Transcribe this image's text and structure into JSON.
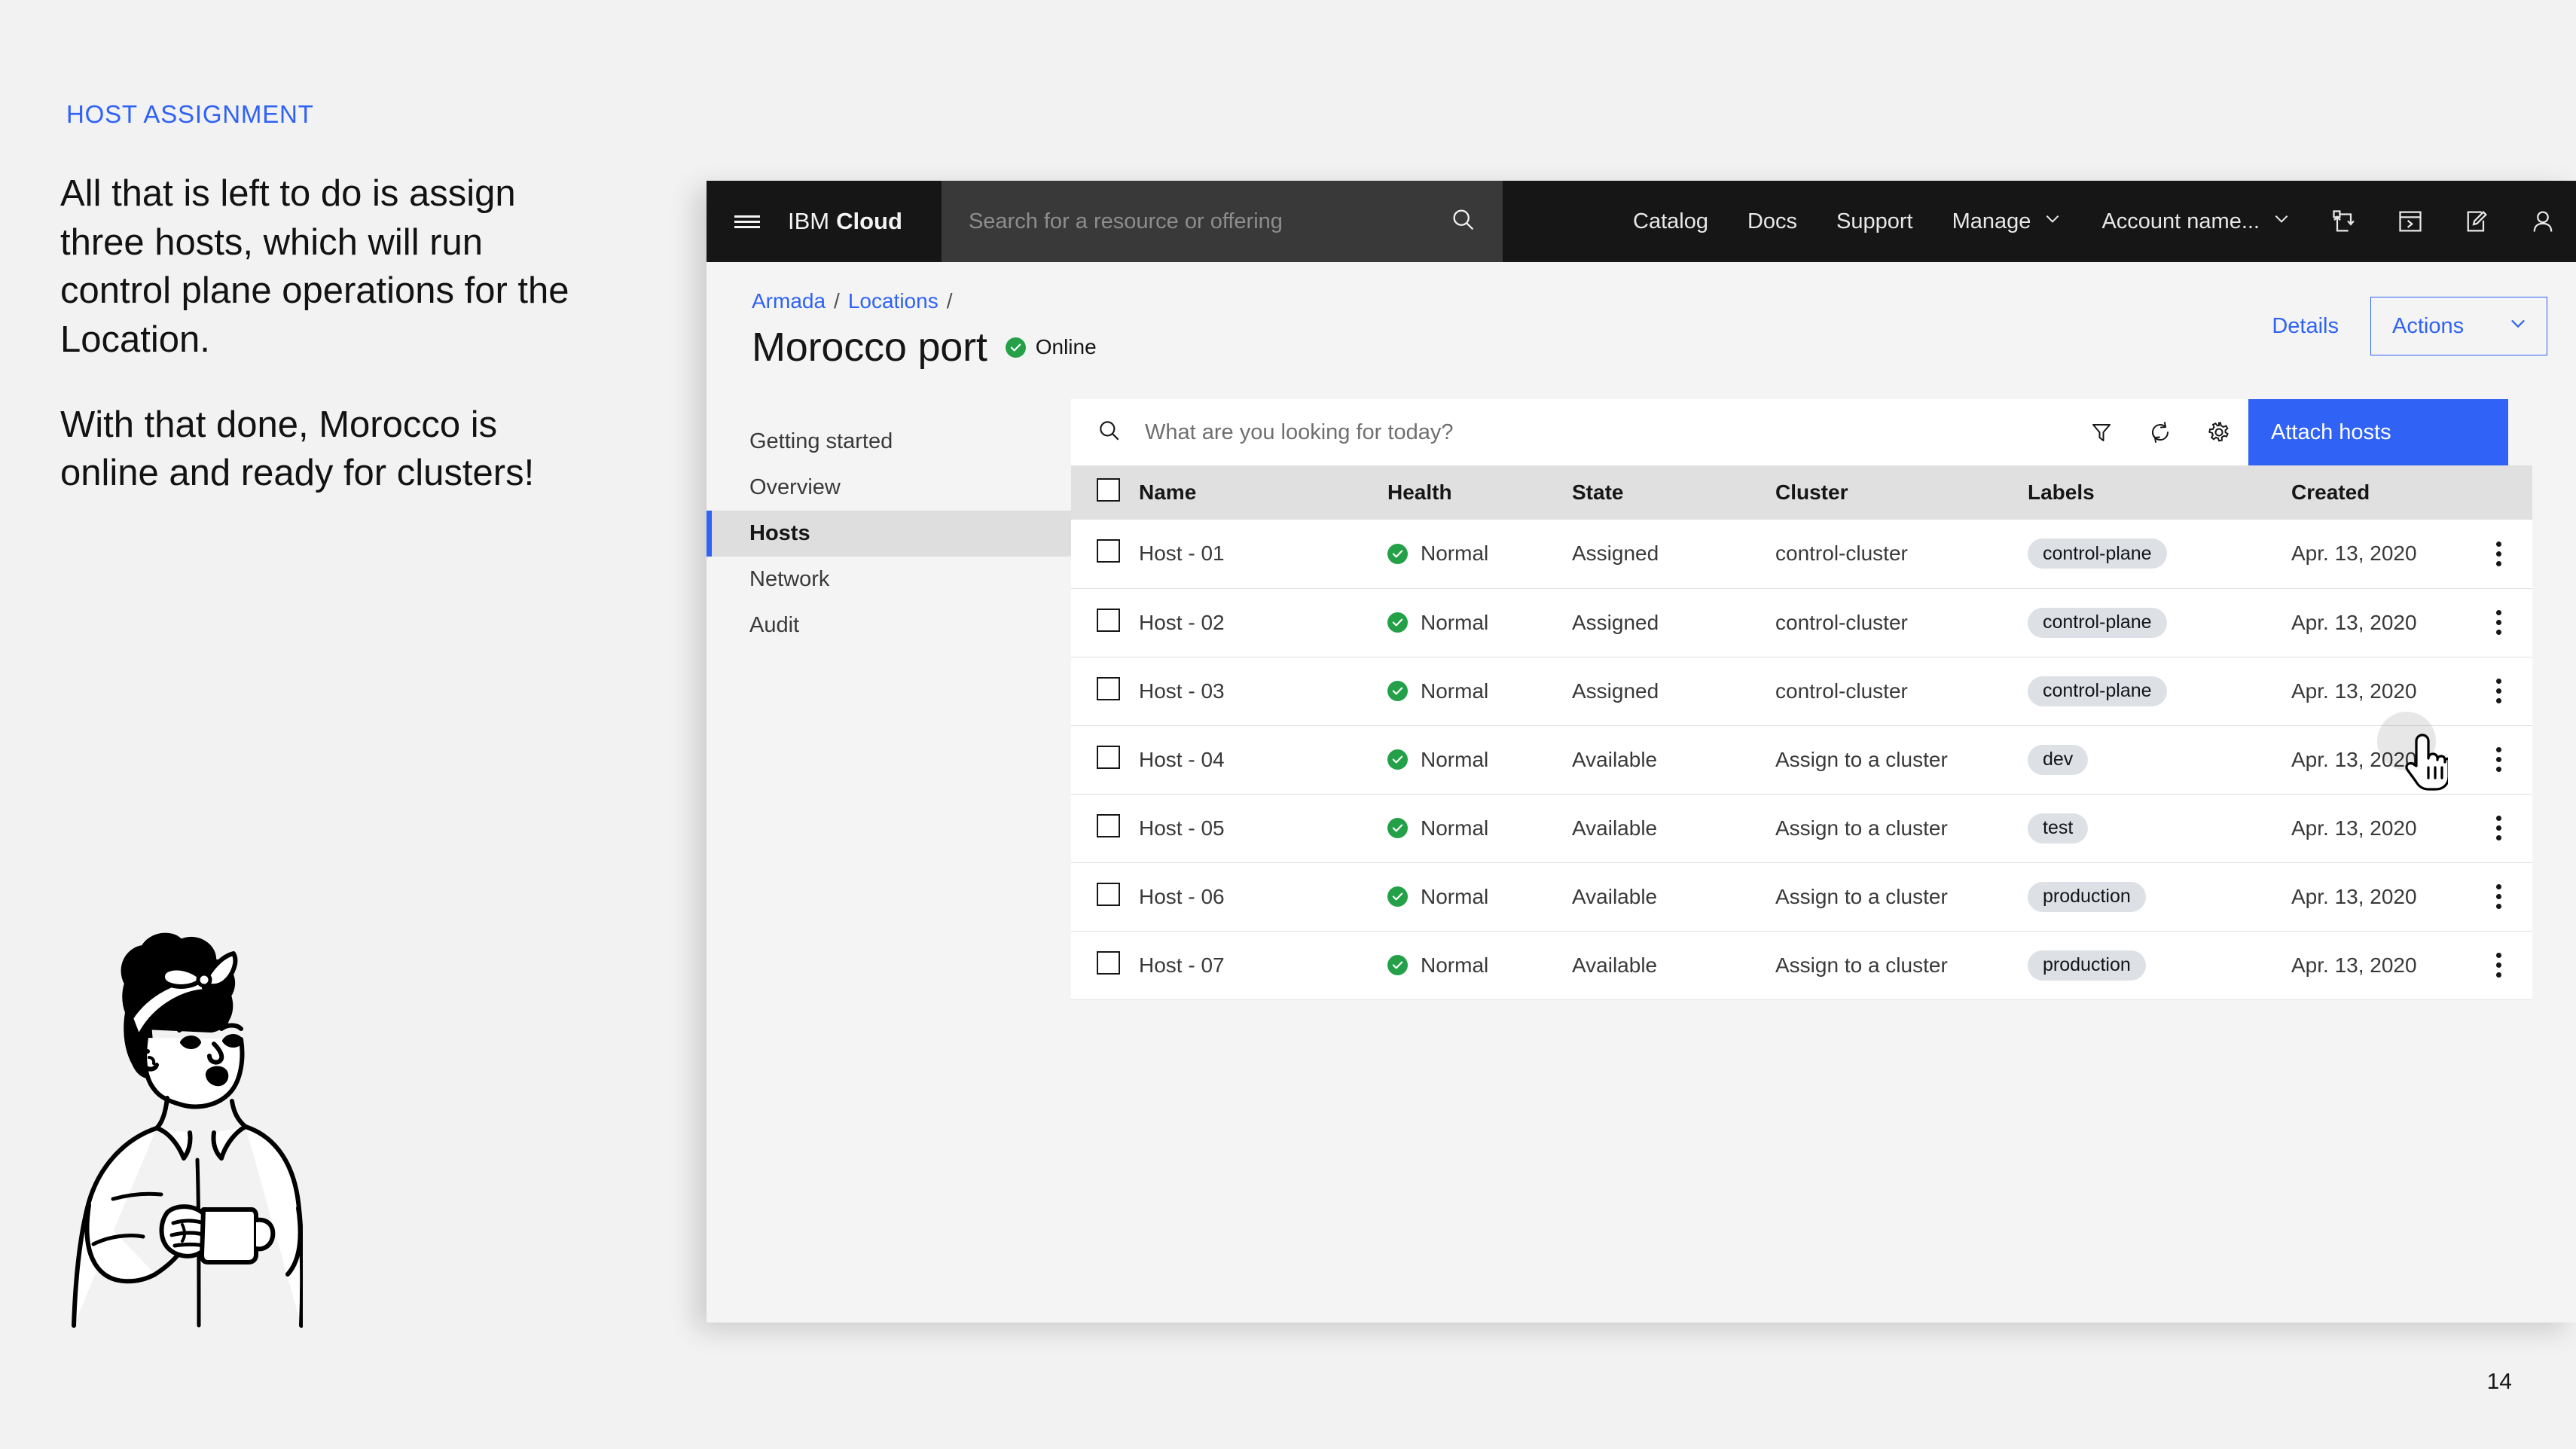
{
  "slide": {
    "eyebrow": "HOST ASSIGNMENT",
    "paragraph_1": "All that is left to do is assign three hosts, which will run control plane operations for the Location.",
    "paragraph_2": "With that done, Morocco is online and ready for clusters!",
    "page_number": "14",
    "accent_color": "#2f62f5"
  },
  "header": {
    "menu_icon": "hamburger-menu-icon",
    "brand_prefix": "IBM",
    "brand_name": "Cloud",
    "search_placeholder": "Search for a resource or offering",
    "search_icon": "search-icon",
    "nav": [
      {
        "label": "Catalog",
        "has_chevron": false
      },
      {
        "label": "Docs",
        "has_chevron": false
      },
      {
        "label": "Support",
        "has_chevron": false
      },
      {
        "label": "Manage",
        "has_chevron": true
      },
      {
        "label": "Account name...",
        "has_chevron": true
      }
    ],
    "icons": [
      "migration-transfer-icon",
      "terminal-console-icon",
      "notebook-edit-icon",
      "user-avatar-icon"
    ],
    "background_color": "#161616",
    "search_background_color": "#393939"
  },
  "page": {
    "breadcrumb": [
      {
        "label": "Armada",
        "link": true
      },
      {
        "label": "Locations",
        "link": true
      }
    ],
    "breadcrumb_separator": "/",
    "title": "Morocco port",
    "status_label": "Online",
    "status_color": "#24a148",
    "status_icon": "check-circle-icon",
    "details_label": "Details",
    "actions_label": "Actions",
    "actions_chevron_icon": "chevron-down-icon"
  },
  "side_nav": {
    "items": [
      {
        "label": "Getting started",
        "active": false
      },
      {
        "label": "Overview",
        "active": false
      },
      {
        "label": "Hosts",
        "active": true
      },
      {
        "label": "Network",
        "active": false
      },
      {
        "label": "Audit",
        "active": false
      }
    ]
  },
  "toolbar": {
    "search_placeholder": "What are you looking for today?",
    "search_icon": "search-icon",
    "filter_icon": "filter-icon",
    "refresh_icon": "refresh-icon",
    "settings_icon": "gear-icon",
    "primary_button_label": "Attach hosts",
    "primary_button_color": "#2f62f5"
  },
  "table": {
    "select_all_checkbox": "",
    "columns": [
      "Name",
      "Health",
      "State",
      "Cluster",
      "Labels",
      "Created"
    ],
    "rows": [
      {
        "name": "Host - 01",
        "health": "Normal",
        "state": "Assigned",
        "cluster": "control-cluster",
        "label": "control-plane",
        "created": "Apr. 13, 2020"
      },
      {
        "name": "Host - 02",
        "health": "Normal",
        "state": "Assigned",
        "cluster": "control-cluster",
        "label": "control-plane",
        "created": "Apr. 13, 2020"
      },
      {
        "name": "Host - 03",
        "health": "Normal",
        "state": "Assigned",
        "cluster": "control-cluster",
        "label": "control-plane",
        "created": "Apr. 13, 2020"
      },
      {
        "name": "Host - 04",
        "health": "Normal",
        "state": "Available",
        "cluster": "Assign to a cluster",
        "label": "dev",
        "created": "Apr. 13, 2020"
      },
      {
        "name": "Host - 05",
        "health": "Normal",
        "state": "Available",
        "cluster": "Assign to a cluster",
        "label": "test",
        "created": "Apr. 13, 2020"
      },
      {
        "name": "Host - 06",
        "health": "Normal",
        "state": "Available",
        "cluster": "Assign to a cluster",
        "label": "production",
        "created": "Apr. 13, 2020"
      },
      {
        "name": "Host - 07",
        "health": "Normal",
        "state": "Available",
        "cluster": "Assign to a cluster",
        "label": "production",
        "created": "Apr. 13, 2020"
      }
    ],
    "row_menu_icon": "kebab-overflow-menu-icon",
    "health_icon": "check-circle-icon",
    "health_color": "#24a148"
  },
  "cursor": {
    "icon": "pointing-hand-cursor",
    "hover_target": "control-cluster"
  }
}
